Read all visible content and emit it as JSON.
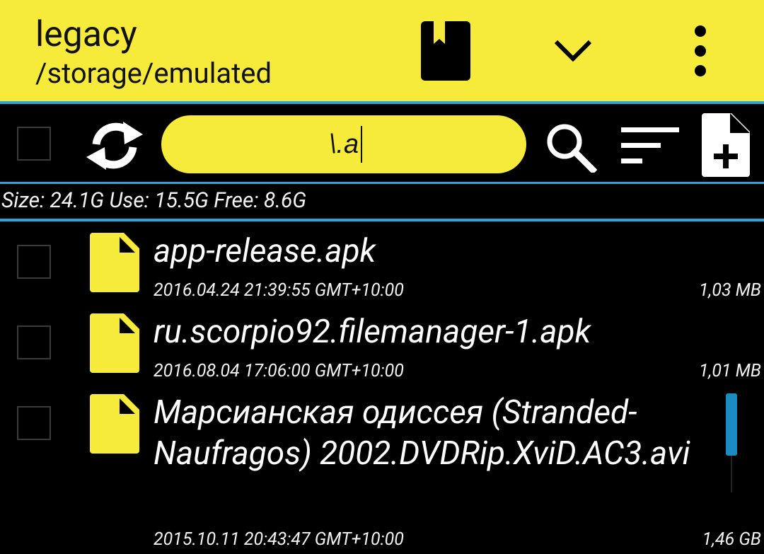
{
  "header": {
    "title": "legacy",
    "path": "/storage/emulated",
    "icons": {
      "bookmark": "bookmark-icon",
      "dropdown": "chevron-down-icon",
      "menu": "more-vertical-icon"
    }
  },
  "toolbar": {
    "search_value": "\\.a",
    "icons": {
      "refresh": "refresh-icon",
      "search": "search-icon",
      "sort": "sort-icon",
      "new_file": "new-file-icon"
    }
  },
  "storage": {
    "text": "Size: 24.1G  Use: 15.5G  Free: 8.6G"
  },
  "files": [
    {
      "name": "app-release.apk",
      "date": "2016.04.24 21:39:55 GMT+10:00",
      "size": "1,03 MB"
    },
    {
      "name": "ru.scorpio92.filemanager-1.apk",
      "date": "2016.08.04 17:06:00 GMT+10:00",
      "size": "1,01 MB"
    },
    {
      "name": "Марсианская одиссея (Stranded-Naufragos) 2002.DVDRip.XviD.AC3.avi",
      "date": "2015.10.11 20:43:47 GMT+10:00",
      "size": "1,46 GB"
    }
  ],
  "colors": {
    "accent_yellow": "#f6eb3a",
    "divider_blue": "#2aa6de",
    "scrollbar_blue": "#1a8cc2",
    "background": "#000000"
  }
}
